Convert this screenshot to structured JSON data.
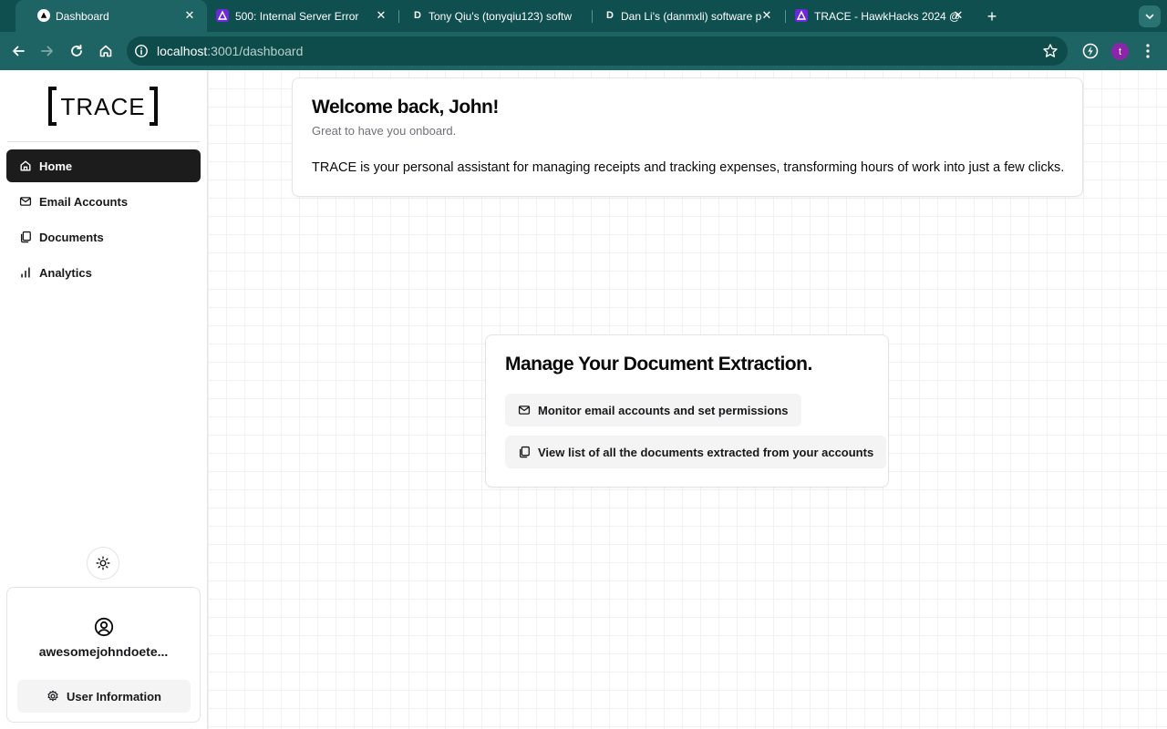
{
  "browser": {
    "tabs": [
      {
        "title": "Dashboard",
        "favicon": "triangle-logo-icon",
        "active": true
      },
      {
        "title": "500: Internal Server Error",
        "favicon": "delta-icon",
        "active": false
      },
      {
        "title": "Tony Qiu's (tonyqiu123) softw",
        "favicon": "D",
        "active": false
      },
      {
        "title": "Dan Li's (danmxli) software p",
        "favicon": "D",
        "active": false
      },
      {
        "title": "TRACE - HawkHacks 2024 @",
        "favicon": "delta-icon",
        "active": false
      }
    ],
    "url": {
      "host": "localhost",
      "path": ":3001/dashboard"
    },
    "profile_initial": "t",
    "colors": {
      "chrome_dark": "#0f4f4f",
      "chrome": "#1f6464",
      "profile": "#8e24aa"
    }
  },
  "sidebar": {
    "logo_text": "TRACE",
    "items": [
      {
        "label": "Home",
        "icon": "home-icon",
        "active": true
      },
      {
        "label": "Email Accounts",
        "icon": "mail-icon",
        "active": false
      },
      {
        "label": "Documents",
        "icon": "documents-icon",
        "active": false
      },
      {
        "label": "Analytics",
        "icon": "bar-chart-icon",
        "active": false
      }
    ],
    "user": {
      "email": "awesomejohndoete...",
      "info_button": "User Information"
    }
  },
  "welcome": {
    "title": "Welcome back, John!",
    "subtitle": "Great to have you onboard.",
    "description": "TRACE is your personal assistant for managing receipts and tracking expenses, transforming hours of work into just a few clicks."
  },
  "manage": {
    "title": "Manage Your Document Extraction.",
    "actions": [
      {
        "label": "Monitor email accounts and set permissions",
        "icon": "mail-icon"
      },
      {
        "label": "View list of all the documents extracted from your accounts",
        "icon": "documents-icon"
      }
    ]
  }
}
